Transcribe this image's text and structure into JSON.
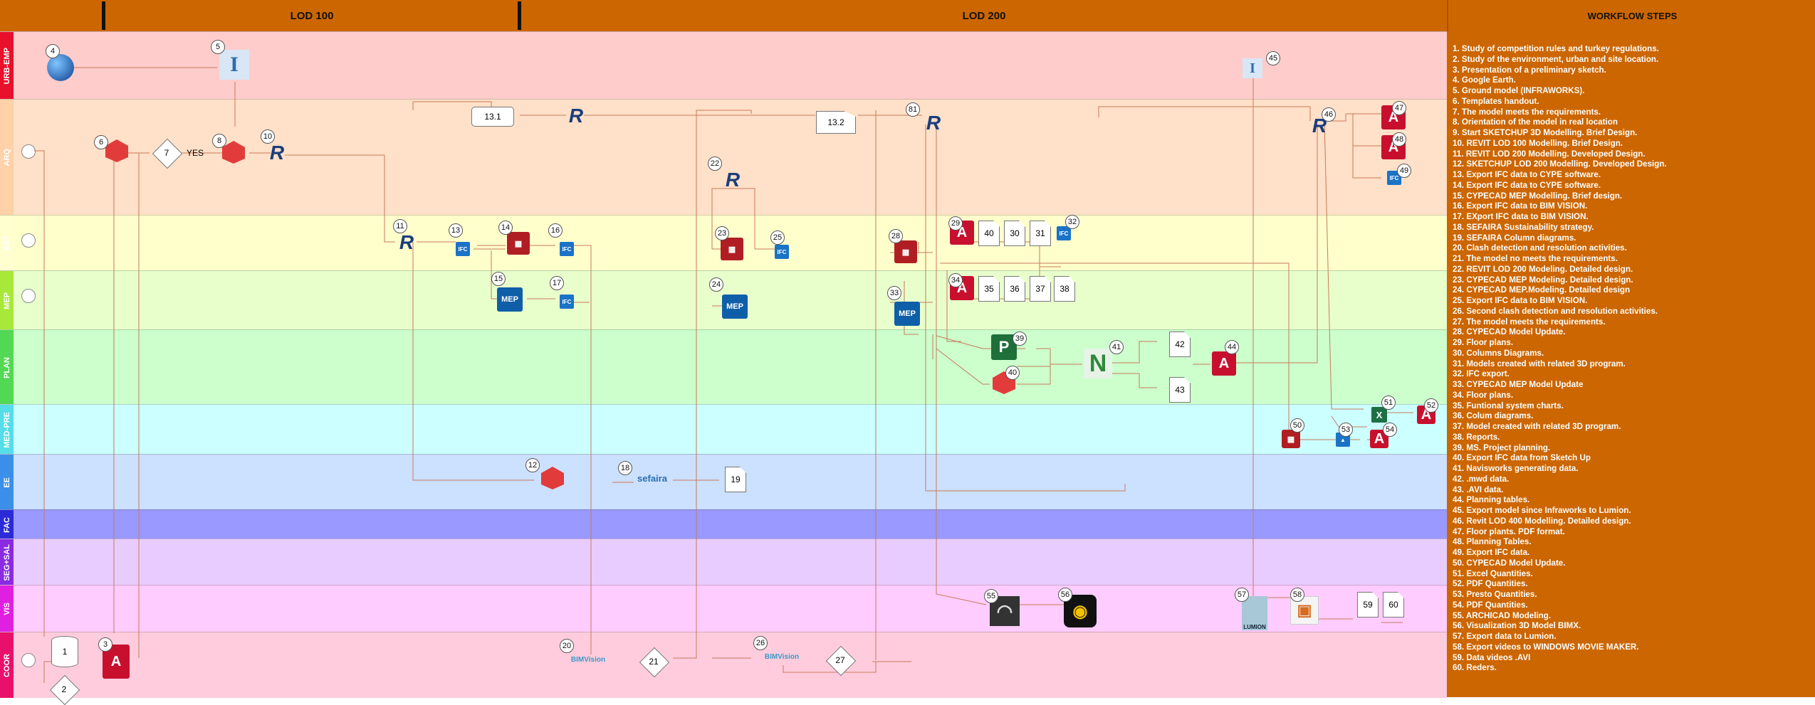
{
  "header": {
    "lod100": "LOD 100",
    "lod200": "LOD 200",
    "workflow_title": "WORKFLOW STEPS"
  },
  "lanes": [
    {
      "id": "urb",
      "label": "URB-EMP",
      "color": "#ffcccc",
      "tag": "#e8102a"
    },
    {
      "id": "arq",
      "label": "ARQ",
      "color": "#ffe0c8",
      "tag": "#ffd1a8"
    },
    {
      "id": "est",
      "label": "EST",
      "color": "#ffffcc",
      "tag": "#ffffd0"
    },
    {
      "id": "mep",
      "label": "MEP",
      "color": "#e8ffcc",
      "tag": "#a8e838"
    },
    {
      "id": "plan",
      "label": "PLAN",
      "color": "#ccffcc",
      "tag": "#52d852"
    },
    {
      "id": "medpre",
      "label": "MED-PRE",
      "color": "#ccffff",
      "tag": "#55dde8"
    },
    {
      "id": "ee",
      "label": "EE",
      "color": "#cce0ff",
      "tag": "#3b8fe8"
    },
    {
      "id": "fac",
      "label": "FAC",
      "color": "#9999ff",
      "tag": "#2a2ad8"
    },
    {
      "id": "seg",
      "label": "SEG+SAL",
      "color": "#e8ccff",
      "tag": "#8a2be2"
    },
    {
      "id": "vis",
      "label": "VIS",
      "color": "#ffccff",
      "tag": "#e020e0"
    },
    {
      "id": "coor",
      "label": "COOR",
      "color": "#ffccdd",
      "tag": "#e8106a"
    }
  ],
  "icons": {
    "google_earth": "globe-icon",
    "infraworks": "infraworks-icon",
    "pdf": "pdf-icon",
    "sketchup": "sketchup-icon",
    "revit": "revit-icon",
    "ifc": "ifc-icon",
    "cypecad": "cypecad-icon",
    "cype_mep": "cype-mep-icon",
    "ms_project": "ms-project-icon",
    "navisworks": "navisworks-icon",
    "excel": "excel-icon",
    "lumion": "lumion-icon",
    "movie_maker": "movie-maker-icon",
    "archicad": "archicad-icon",
    "bimx": "bimx-icon"
  },
  "labels": {
    "yes": "YES",
    "mep_text": "MEP",
    "ifc_text": "IFC",
    "bimvision_text": "BIMVision",
    "sefaira_text": "sefaira",
    "lumion_text": "LUMION",
    "navis_sub": "M"
  },
  "nodes": {
    "n1": "1",
    "n2": "2",
    "n3": "3",
    "n4": "4",
    "n5": "5",
    "n6": "6",
    "n7": "7",
    "n8": "8",
    "n10": "10",
    "n11": "11",
    "n12": "12",
    "n13": "13",
    "n14": "14",
    "n15": "15",
    "n16": "16",
    "n17": "17",
    "n18": "18",
    "n19": "19",
    "n20": "20",
    "n21": "21",
    "n22": "22",
    "n23": "23",
    "n24": "24",
    "n25": "25",
    "n26": "26",
    "n27": "27",
    "n28": "28",
    "n29": "29",
    "n30": "30",
    "n31": "31",
    "n32": "32",
    "n33": "33",
    "n34": "34",
    "n35": "35",
    "n36": "36",
    "n37": "37",
    "n38": "38",
    "n39": "39",
    "n40": "40",
    "n41": "41",
    "n42": "42",
    "n43": "43",
    "n44": "44",
    "n45": "45",
    "n46": "46",
    "n47": "47",
    "n48": "48",
    "n49": "49",
    "n50": "50",
    "n51": "51",
    "n52": "52",
    "n53": "53",
    "n54": "54",
    "n55": "55",
    "n56": "56",
    "n57": "57",
    "n58": "58",
    "n59": "59",
    "n60": "60",
    "n81": "81",
    "b13_1": "13.1",
    "b13_2": "13.2"
  },
  "workflow_steps": [
    "1. Study of competition rules and turkey regulations.",
    "2. Study of the environment, urban and site location.",
    "3. Presentation of a preliminary sketch.",
    "4. Google Earth.",
    "5. Ground model (INFRAWORKS).",
    "6. Templates handout.",
    "7. The model meets the requirements.",
    "8. Orientation of the model in real location",
    "9. Start SKETCHUP 3D Modelling. Brief Design.",
    "10. REVIT LOD 100 Modelling. Brief Design.",
    "11. REVIT LOD 200 Modelling. Developed Design.",
    "12. SKETCHUP LOD 200 Modelling. Developed Design.",
    "13. Export IFC data to CYPE software.",
    "14. Export IFC data to CYPE software.",
    "15. CYPECAD MEP Modelling. Brief design.",
    "16. Export IFC data to BIM VISION.",
    "17. EXport IFC data to BIM VISION.",
    "18. SEFAIRA Sustainability strategy.",
    "19. SEFAIRA Column diagrams.",
    "20. Clash detection and resolution activities.",
    "21. The model no meets the requirements.",
    "22. REVIT LOD 200 Modeling. Detailed design.",
    "23. CYPECAD MEP Modeling. Detailed design.",
    "24. CYPECAD MEP.Modeling. Detailed design",
    "25. Export IFC data to BIM VISION.",
    "26. Second clash detection and resolution activities.",
    "27. The model meets the requirements.",
    "28. CYPECAD Model Update.",
    "29. Floor plans.",
    "30. Columns Diagrams.",
    "31. Models created with related 3D program.",
    "32. IFC export.",
    "33. CYPECAD MEP Model Update",
    "34. Floor plans.",
    "35. Funtional system charts.",
    "36. Colum diagrams.",
    "37. Model created with related 3D program.",
    "38. Reports.",
    "39. MS. Project planning.",
    "40. Export IFC data from Sketch Up",
    "41. Navisworks generating data.",
    "42. .mwd data.",
    "43. .AVI data.",
    "44. Planning tables.",
    "45. Export model since Infraworks to Lumion.",
    "46. Revit LOD 400 Modelling. Detailed design.",
    "47. Floor plants. PDF format.",
    "48. Planning Tables.",
    "49. Export IFC data.",
    "50. CYPECAD Model Update.",
    "51. Excel Quantities.",
    "52. PDF Quantities.",
    "53. Presto Quantities.",
    "54. PDF Quantities.",
    "55.  ARCHICAD Modeling.",
    "56. Visualization 3D  Model BIMX.",
    "57. Export data to Lumion.",
    "58. Export videos to WINDOWS MOVIE MAKER.",
    "59. Data videos .AVI",
    "60. Reders."
  ]
}
